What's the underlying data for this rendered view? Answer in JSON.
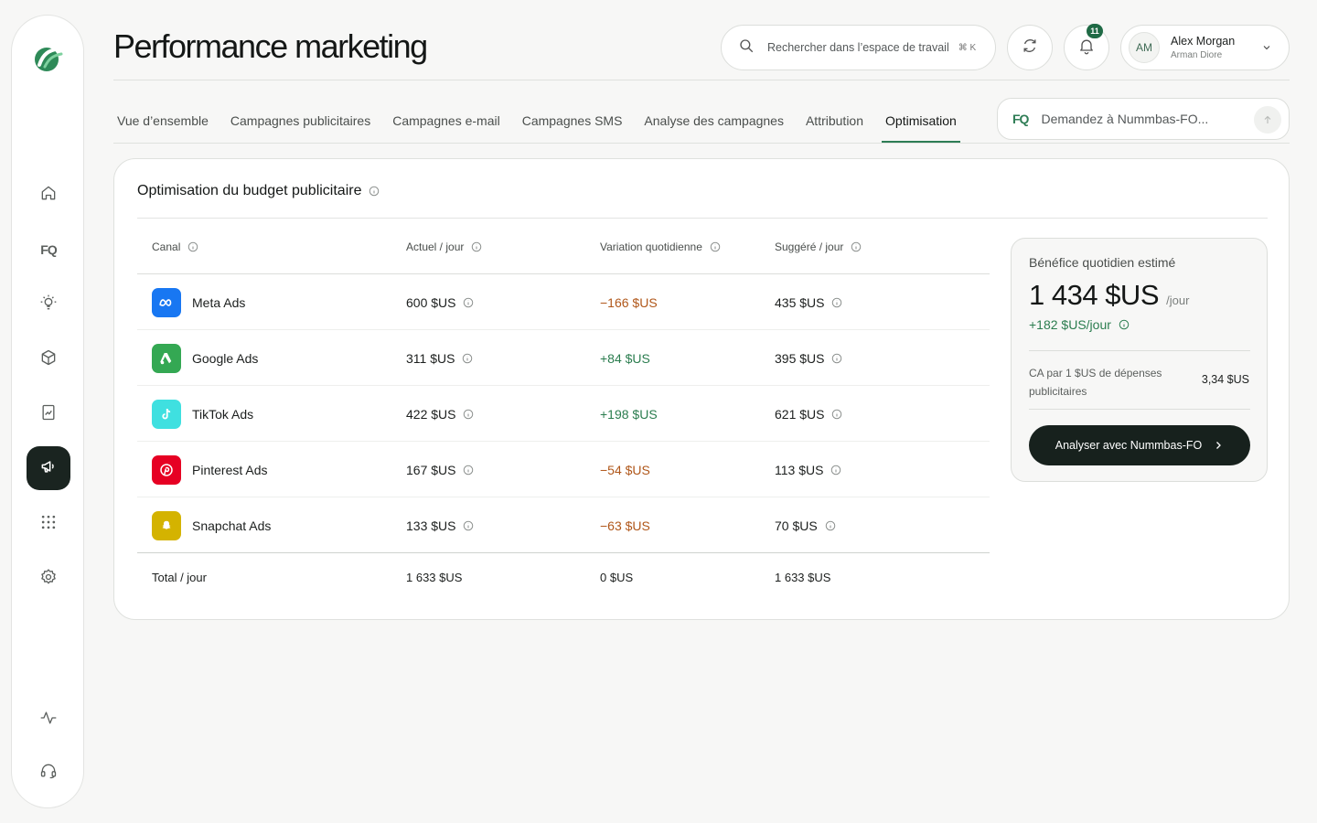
{
  "header": {
    "title": "Performance marketing",
    "search_placeholder": "Rechercher dans l’espace de travail",
    "search_shortcut": "⌘ K",
    "notifications_count": "11",
    "user": {
      "initials": "AM",
      "name": "Alex Morgan",
      "org": "Arman Diore"
    }
  },
  "sidebar": {
    "fo_label": "FQ",
    "items": [
      "home-icon",
      "fo-icon",
      "lightbulb-icon",
      "box-icon",
      "report-icon",
      "megaphone-icon",
      "grid-icon",
      "settings-icon",
      "activity-icon",
      "headset-icon"
    ],
    "active": "megaphone-icon"
  },
  "tabs": [
    {
      "label": "Vue d’ensemble"
    },
    {
      "label": "Campagnes publicitaires"
    },
    {
      "label": "Campagnes e-mail"
    },
    {
      "label": "Campagnes SMS"
    },
    {
      "label": "Analyse des campagnes"
    },
    {
      "label": "Attribution"
    },
    {
      "label": "Optimisation",
      "active": true
    }
  ],
  "assistant": {
    "logo": "FQ",
    "placeholder": "Demandez à Nummbas-FO..."
  },
  "card": {
    "title": "Optimisation du budget publicitaire",
    "columns": [
      "Canal",
      "Actuel / jour",
      "Variation quotidienne",
      "Suggéré / jour"
    ],
    "rows": [
      {
        "channel": "Meta Ads",
        "icon": "meta-icon",
        "color": "#1877f2",
        "current": "600 $US",
        "variation": "−166 $US",
        "trend": "neg",
        "suggested": "435 $US"
      },
      {
        "channel": "Google Ads",
        "icon": "google-ads-icon",
        "color": "#34a853",
        "current": "311 $US",
        "variation": "+84 $US",
        "trend": "pos",
        "suggested": "395 $US"
      },
      {
        "channel": "TikTok Ads",
        "icon": "tiktok-icon",
        "color": "#3fe0e0",
        "current": "422 $US",
        "variation": "+198 $US",
        "trend": "pos",
        "suggested": "621 $US"
      },
      {
        "channel": "Pinterest Ads",
        "icon": "pinterest-icon",
        "color": "#e60023",
        "current": "167 $US",
        "variation": "−54 $US",
        "trend": "neg",
        "suggested": "113 $US"
      },
      {
        "channel": "Snapchat Ads",
        "icon": "snapchat-icon",
        "color": "#d4b300",
        "current": "133 $US",
        "variation": "−63 $US",
        "trend": "neg",
        "suggested": "70 $US"
      }
    ],
    "total": {
      "label": "Total / jour",
      "current": "1 633 $US",
      "variation": "0 $US",
      "suggested": "1 633 $US"
    }
  },
  "profit": {
    "label": "Bénéfice quotidien estimé",
    "value": "1 434 $US",
    "unit": "/jour",
    "delta": "+182 $US/jour",
    "roi_label": "CA par 1 $US de dépenses publicitaires",
    "roi_value": "3,34 $US",
    "button": "Analyser avec Nummbas-FO"
  },
  "colors": {
    "accent": "#2e7d55",
    "negative": "#b0571a",
    "positive": "#2b7d4f",
    "dark": "#17211d"
  }
}
